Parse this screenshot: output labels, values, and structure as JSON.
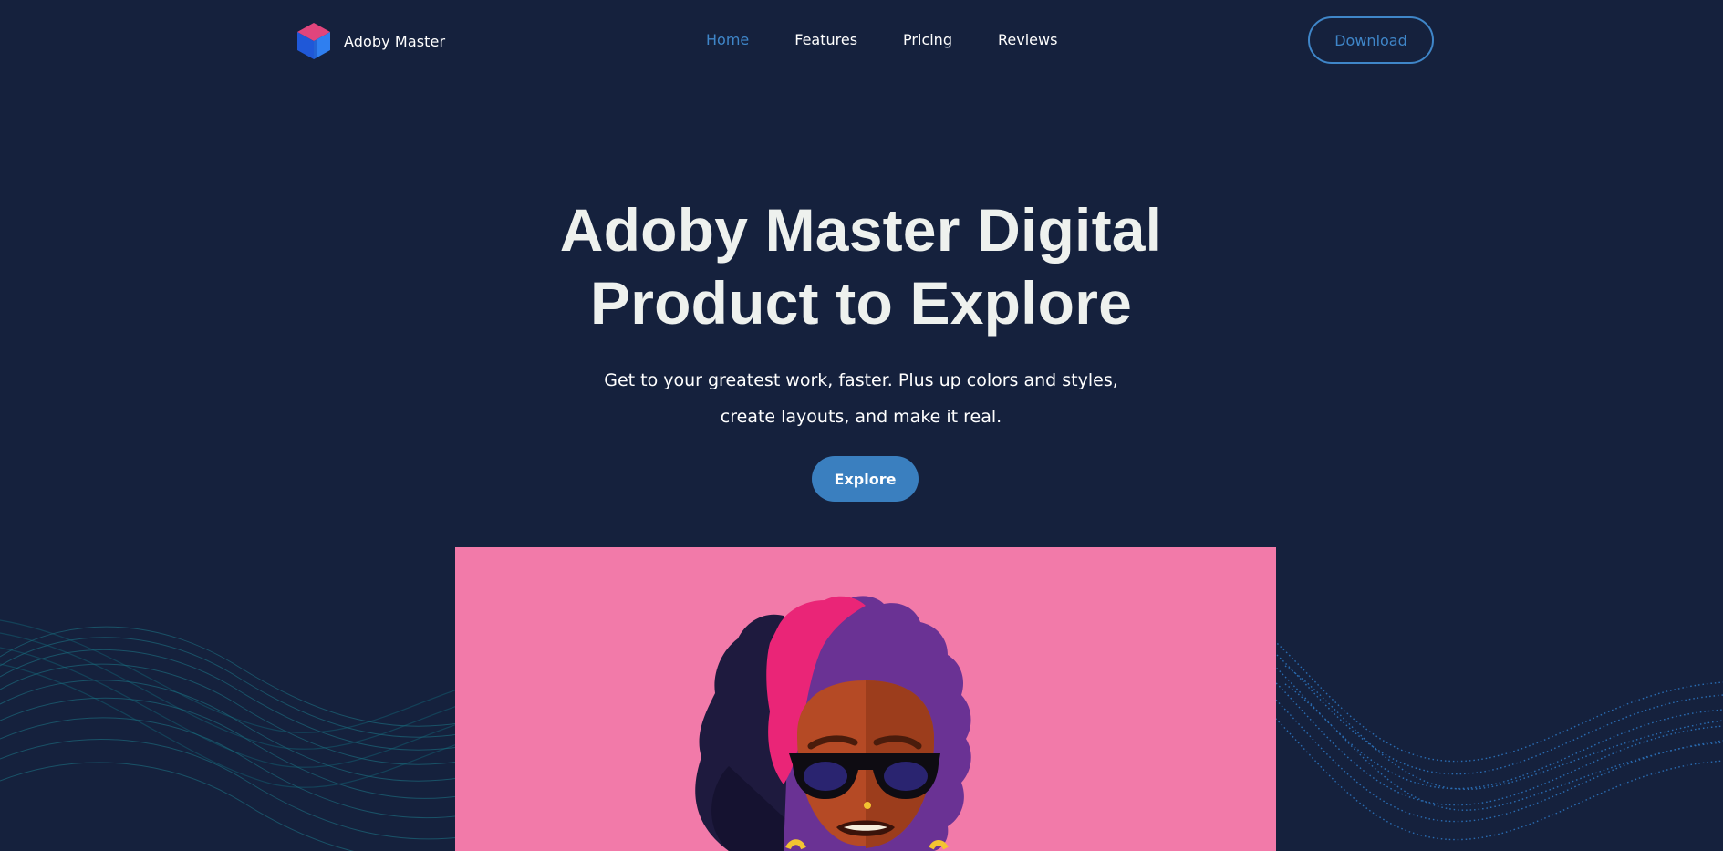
{
  "brand": {
    "name": "Adoby Master",
    "logo_icon": "cube-logo-icon"
  },
  "nav": {
    "items": [
      {
        "label": "Home",
        "active": true
      },
      {
        "label": "Features",
        "active": false
      },
      {
        "label": "Pricing",
        "active": false
      },
      {
        "label": "Reviews",
        "active": false
      }
    ],
    "download_label": "Download"
  },
  "hero": {
    "title_line1": "Adoby Master Digital",
    "title_line2": "Product to Explore",
    "subtitle_line1": "Get to your greatest work, faster. Plus up colors and styles,",
    "subtitle_line2": "create layouts, and make it real.",
    "cta_label": "Explore"
  },
  "colors": {
    "background": "#15213d",
    "accent": "#3f86c9",
    "button_fill": "#3a7fbf",
    "illustration_bg": "#f27aa9",
    "title_text": "#eef1ee"
  },
  "illustration": {
    "subject": "woman-with-afro-and-sunglasses-illustration"
  }
}
